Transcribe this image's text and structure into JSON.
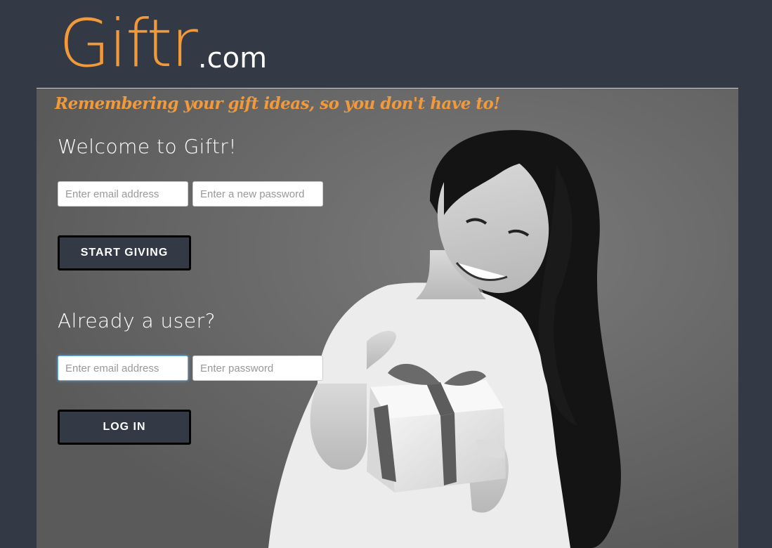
{
  "logo": {
    "main": "Giftr",
    "suffix": ".com"
  },
  "tagline": "Remembering your gift ideas, so you don't have to!",
  "signup": {
    "heading": "Welcome to Giftr!",
    "email_placeholder": "Enter email address",
    "password_placeholder": "Enter a new password",
    "button_label": "START GIVING"
  },
  "login": {
    "heading": "Already a user?",
    "email_placeholder": "Enter email address",
    "password_placeholder": "Enter password",
    "button_label": "LOG IN"
  },
  "colors": {
    "page_background": "#333a46",
    "accent_orange": "#f2993a",
    "button_background": "#333a46",
    "focus_border": "#66afe9"
  }
}
